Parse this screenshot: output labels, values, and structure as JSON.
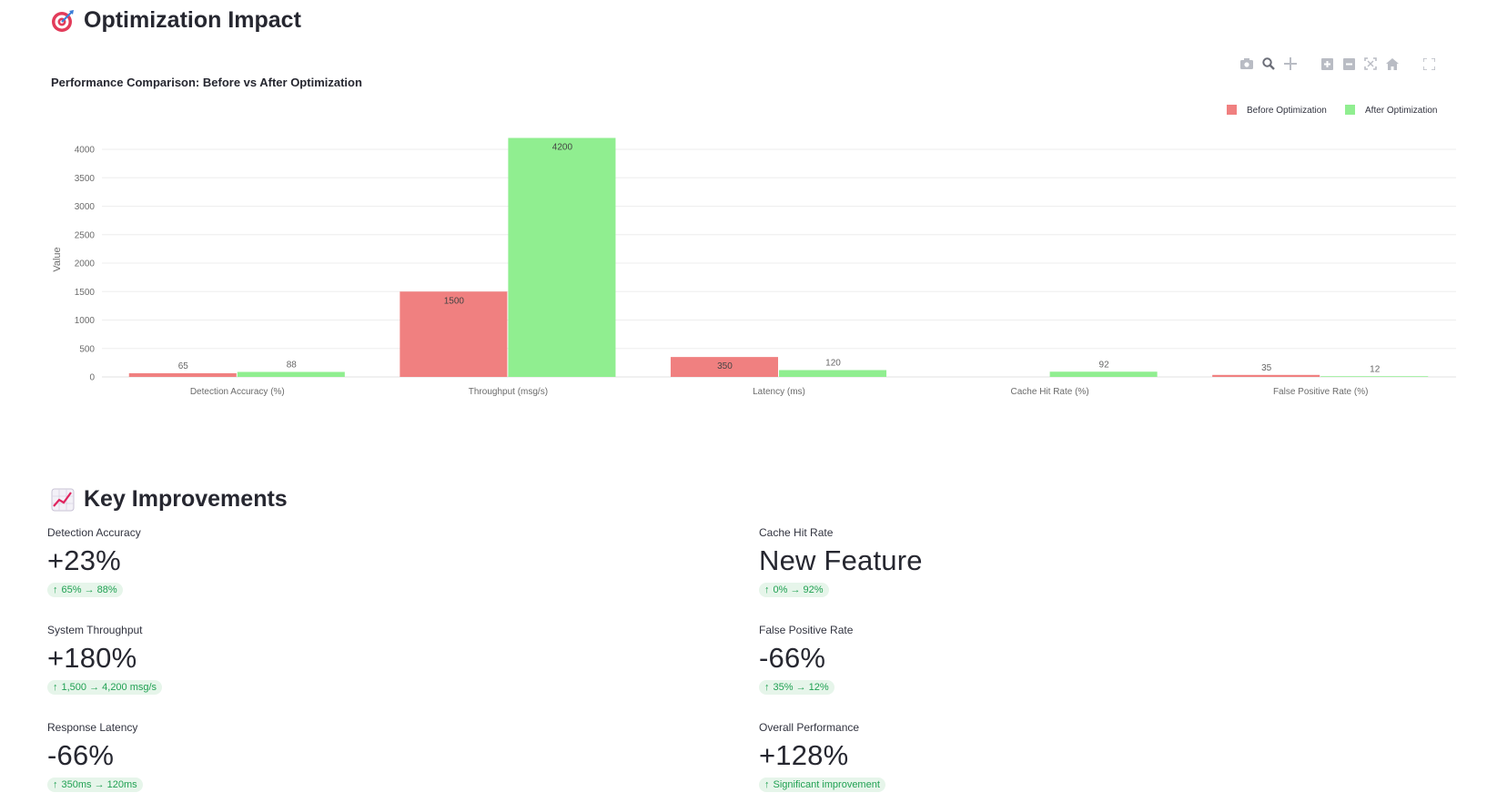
{
  "page": {
    "title": "Optimization Impact",
    "title_icon": "target-icon",
    "section2_title": "Key Improvements",
    "section2_icon": "chart-increasing-icon"
  },
  "modebar": {
    "icons": [
      "camera-icon",
      "zoom-icon",
      "pan-icon",
      "zoom-in-icon",
      "zoom-out-icon",
      "autoscale-icon",
      "reset-axes-icon",
      "fullscreen-icon"
    ]
  },
  "chart_data": {
    "type": "bar",
    "title": "Performance Comparison: Before vs After Optimization",
    "xlabel": "",
    "ylabel": "Value",
    "ylim": [
      0,
      4000
    ],
    "yticks": [
      0,
      500,
      1000,
      1500,
      2000,
      2500,
      3000,
      3500,
      4000
    ],
    "grid": true,
    "legend_position": "top-right",
    "categories": [
      "Detection Accuracy (%)",
      "Throughput (msg/s)",
      "Latency (ms)",
      "Cache Hit Rate (%)",
      "False Positive Rate (%)"
    ],
    "series": [
      {
        "name": "Before Optimization",
        "color": "#f08080",
        "values": [
          65,
          1500,
          350,
          0,
          35
        ],
        "labels": [
          "65",
          "1500",
          "350",
          "",
          "35"
        ]
      },
      {
        "name": "After Optimization",
        "color": "#90ee90",
        "values": [
          88,
          4200,
          120,
          92,
          12
        ],
        "labels": [
          "88",
          "4200",
          "120",
          "92",
          "12"
        ]
      }
    ]
  },
  "metrics": [
    {
      "label": "Detection Accuracy",
      "value": "+23%",
      "delta": "65% → 88%"
    },
    {
      "label": "System Throughput",
      "value": "+180%",
      "delta": "1,500 → 4,200 msg/s"
    },
    {
      "label": "Response Latency",
      "value": "-66%",
      "delta": "350ms → 120ms"
    },
    {
      "label": "Cache Hit Rate",
      "value": "New Feature",
      "delta": "0% → 92%"
    },
    {
      "label": "False Positive Rate",
      "value": "-66%",
      "delta": "35% → 12%"
    },
    {
      "label": "Overall Performance",
      "value": "+128%",
      "delta": "Significant improvement"
    }
  ],
  "colors": {
    "delta_bg": "#e6f5ea",
    "delta_text": "#21a153",
    "grid": "#eeeeee",
    "axis_text": "#6b6b6b"
  }
}
